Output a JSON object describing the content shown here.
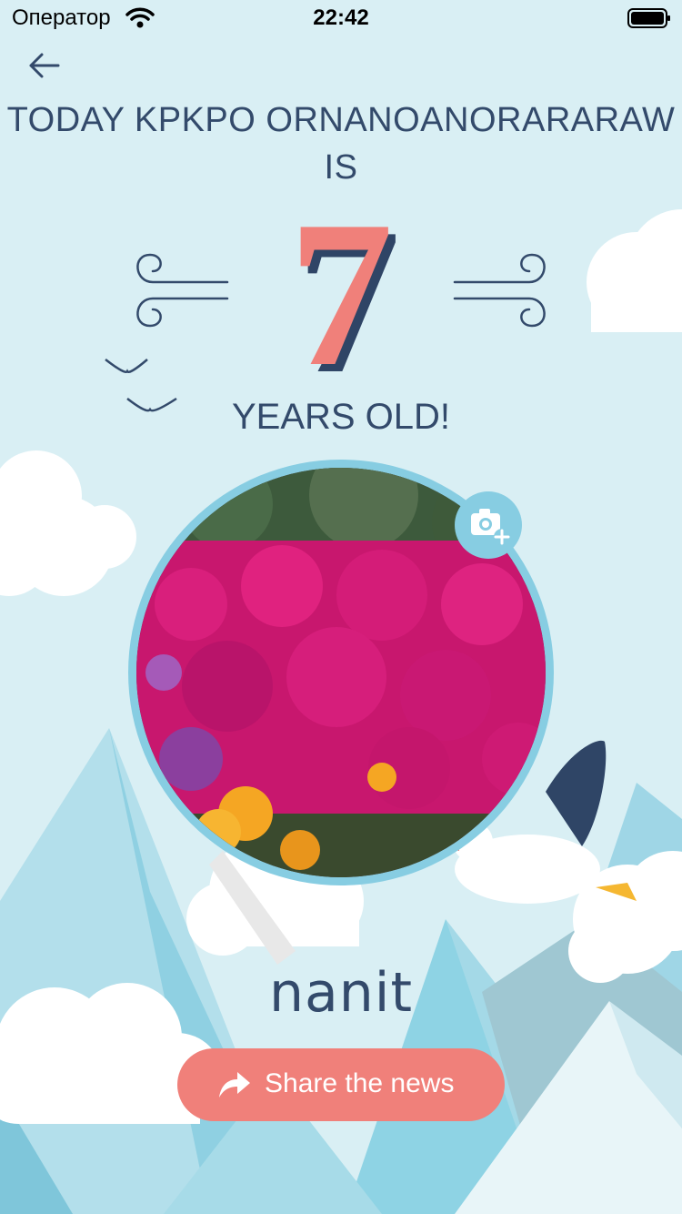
{
  "status_bar": {
    "carrier": "Оператор",
    "time": "22:42"
  },
  "header": {
    "back_icon": "arrow-left-icon"
  },
  "card": {
    "title": "TODAY KPKPO ORNANOANORARARAW IS",
    "age_number": "7",
    "age_caption": "YEARS OLD!",
    "photo_subject": "pink and yellow ice plant flowers",
    "camera_icon": "camera-plus-icon"
  },
  "brand": {
    "logo_text": "nanit"
  },
  "share": {
    "label": "Share the news",
    "icon": "share-arrow-icon"
  },
  "colors": {
    "sky": "#d9eff4",
    "navy": "#334a6b",
    "accent": "#f0807a",
    "ring": "#87cde2",
    "mountain_dark": "#8ecfe0",
    "mountain_light": "#b7e0ea"
  }
}
